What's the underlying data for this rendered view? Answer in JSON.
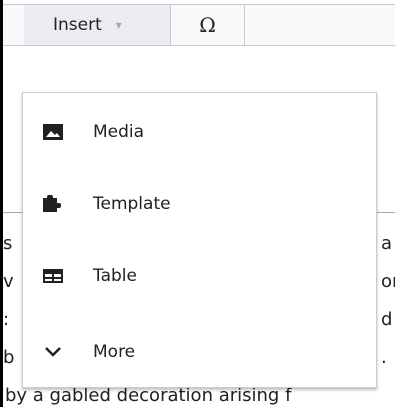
{
  "toolbar": {
    "insert_label": "Insert",
    "insert_caret": "▾",
    "special_char_label": "Ω"
  },
  "insert_menu": {
    "items": [
      {
        "label": "Media",
        "icon": "image-icon"
      },
      {
        "label": "Template",
        "icon": "puzzle-icon"
      },
      {
        "label": "Table",
        "icon": "table-icon"
      },
      {
        "label": "More",
        "icon": "chevron-down-icon"
      }
    ]
  },
  "article": {
    "left_fragments": [
      "s",
      "v",
      ":",
      "b"
    ],
    "right_fragments": [
      "a",
      "or",
      "d",
      "."
    ],
    "bottom_line": "by a gabled decoration arising f"
  },
  "colors": {
    "toolbar_bg": "#f8f9fa",
    "active_button_bg": "#eaecf0",
    "border": "#c8ccd1",
    "text": "#202122"
  }
}
